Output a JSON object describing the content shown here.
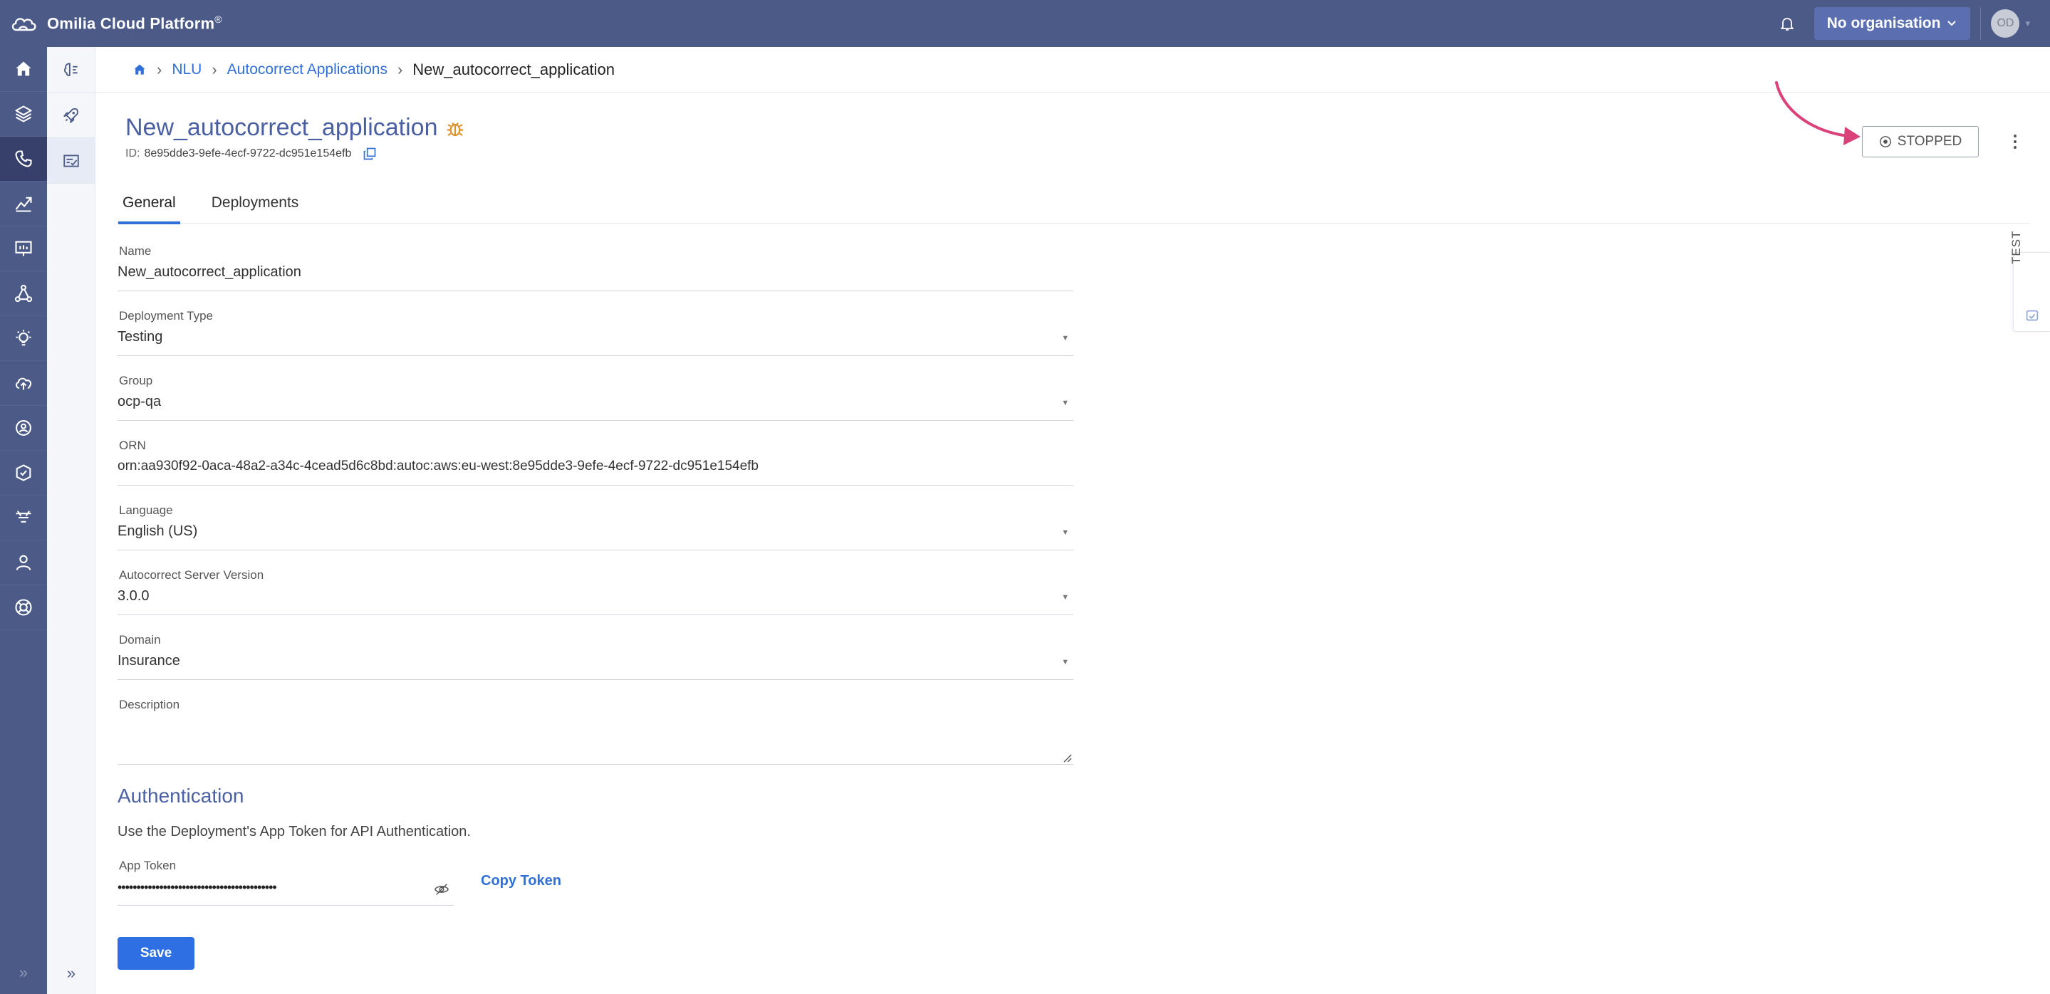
{
  "app": {
    "title": "Omilia Cloud Platform",
    "title_mark": "®",
    "organisation": "No organisation",
    "avatar_initials": "OD"
  },
  "breadcrumb": {
    "items": [
      "NLU",
      "Autocorrect Applications"
    ],
    "current": "New_autocorrect_application"
  },
  "header": {
    "title": "New_autocorrect_application",
    "id_label": "ID:",
    "id_value": "8e95dde3-9efe-4ecf-9722-dc951e154efb",
    "status": "STOPPED"
  },
  "tabs": [
    {
      "label": "General",
      "active": true
    },
    {
      "label": "Deployments",
      "active": false
    }
  ],
  "form": {
    "name": {
      "label": "Name",
      "value": "New_autocorrect_application"
    },
    "deployment_type": {
      "label": "Deployment Type",
      "value": "Testing"
    },
    "group": {
      "label": "Group",
      "value": "ocp-qa"
    },
    "orn": {
      "label": "ORN",
      "value": "orn:aa930f92-0aca-48a2-a34c-4cead5d6c8bd:autoc:aws:eu-west:8e95dde3-9efe-4ecf-9722-dc951e154efb"
    },
    "language": {
      "label": "Language",
      "value": "English (US)"
    },
    "server_version": {
      "label": "Autocorrect Server Version",
      "value": "3.0.0"
    },
    "domain": {
      "label": "Domain",
      "value": "Insurance"
    },
    "description": {
      "label": "Description",
      "value": ""
    }
  },
  "auth": {
    "title": "Authentication",
    "description": "Use the Deployment's App Token for API Authentication.",
    "token_label": "App Token",
    "token_masked": "••••••••••••••••••••••••••••••••••••••••••",
    "copy_label": "Copy Token"
  },
  "save_label": "Save",
  "test_tab_label": "TEST",
  "colors": {
    "nav_bg": "#4b5a86",
    "accent": "#2f6fd6",
    "title": "#4b5fa3",
    "arrow": "#d9437a"
  },
  "icons": {
    "left_nav": [
      "home-icon",
      "layers-icon",
      "phone-icon",
      "analytics-icon",
      "presentation-icon",
      "network-icon",
      "lightbulb-icon",
      "cloud-upload-icon",
      "gear-people-icon",
      "shield-gear-icon",
      "filter-icon",
      "user-icon",
      "lifebuoy-icon"
    ],
    "sub_nav": [
      "brain-icon",
      "rocket-icon",
      "spellcheck-icon"
    ]
  }
}
